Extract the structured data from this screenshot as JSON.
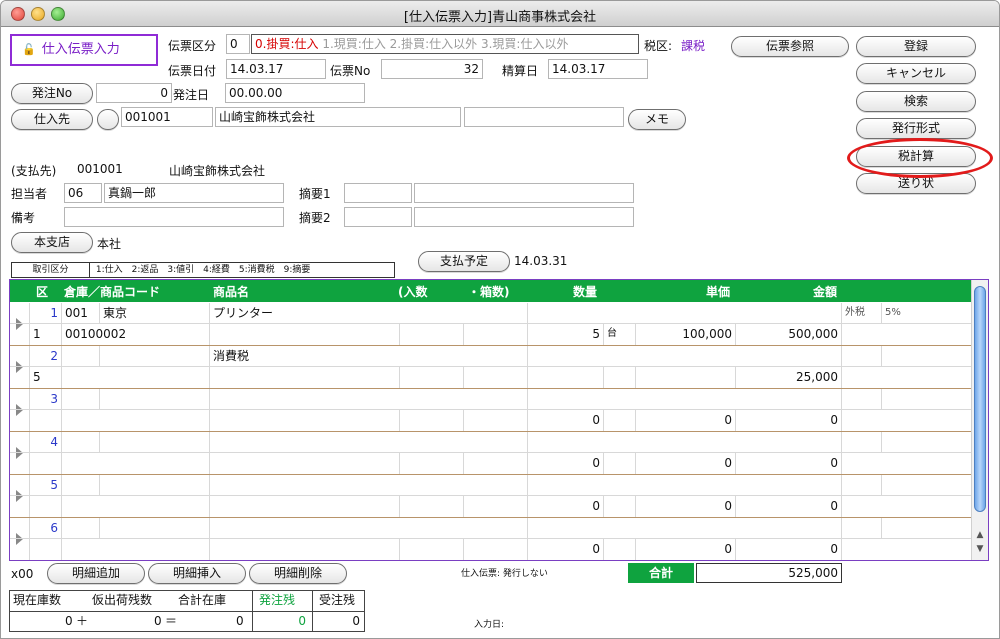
{
  "window": {
    "title": "[仕入伝票入力]青山商事株式会社"
  },
  "header": {
    "mode_badge": "仕入伝票入力",
    "denpyo_kubun_label": "伝票区分",
    "denpyo_kubun_value": "0",
    "kubun_options": [
      "0.掛買:仕入",
      "1.現買:仕入",
      "2.掛買:仕入以外",
      "3.現買:仕入以外"
    ],
    "tax_label": "税区:",
    "tax_value": "課税",
    "date_label": "伝票日付",
    "date_value": "14.03.17",
    "no_label": "伝票No",
    "no_value": "32",
    "seisan_label": "精算日",
    "seisan_value": "14.03.17",
    "hacchu_no_button": "発注No",
    "hacchu_no_value": "0",
    "hacchu_date_label": "発注日",
    "hacchu_date_value": "00.00.00",
    "shiiresaki_button": "仕入先",
    "shiiresaki_code": "001001",
    "shiiresaki_name": "山崎宝飾株式会社",
    "memo_button": "メモ",
    "shiharai_label": "(支払先)",
    "shiharai_code": "001001",
    "shiharai_name": "山崎宝飾株式会社",
    "tantou_label": "担当者",
    "tantou_code": "06",
    "tantou_name": "真鍋一郎",
    "bikou_label": "備考",
    "tekiyou1_label": "摘要1",
    "tekiyou2_label": "摘要2",
    "honshiten_button": "本支店",
    "honshiten_value": "本社",
    "torihiki_kubun": "取引区分",
    "torihiki_options": "1:仕入　2:返品　3:値引　4:経費　5:消費税　9:摘要",
    "shiharai_yotei_button": "支払予定",
    "shiharai_yotei_value": "14.03.31"
  },
  "side_buttons": {
    "denpyo_sansho": "伝票参照",
    "touroku": "登録",
    "cancel": "キャンセル",
    "kensaku": "検索",
    "hakkou": "発行形式",
    "zeikeisan": "税計算",
    "okurijou": "送り状"
  },
  "grid": {
    "headers": [
      "区",
      "倉庫／商品コード",
      "商品名",
      "(入数",
      "・箱数)",
      "数量",
      "単価",
      "金額"
    ],
    "rows": [
      {
        "line": "1",
        "soko": "001",
        "soko_name": "東京",
        "name": "プリンター",
        "tax_note": "外税",
        "tax_rate": "5%",
        "kubun": "1",
        "code": "00100002",
        "qty": "5",
        "unit": "台",
        "price": "100,000",
        "amount": "500,000"
      },
      {
        "line": "2",
        "soko": "",
        "soko_name": "",
        "name": "消費税",
        "tax_note": "",
        "tax_rate": "",
        "kubun": "5",
        "code": "",
        "qty": "",
        "unit": "",
        "price": "",
        "amount": "25,000"
      },
      {
        "line": "3",
        "soko": "",
        "soko_name": "",
        "name": "",
        "tax_note": "",
        "tax_rate": "",
        "kubun": "",
        "code": "",
        "qty": "0",
        "unit": "",
        "price": "0",
        "amount": "0"
      },
      {
        "line": "4",
        "soko": "",
        "soko_name": "",
        "name": "",
        "tax_note": "",
        "tax_rate": "",
        "kubun": "",
        "code": "",
        "qty": "0",
        "unit": "",
        "price": "0",
        "amount": "0"
      },
      {
        "line": "5",
        "soko": "",
        "soko_name": "",
        "name": "",
        "tax_note": "",
        "tax_rate": "",
        "kubun": "",
        "code": "",
        "qty": "0",
        "unit": "",
        "price": "0",
        "amount": "0"
      },
      {
        "line": "6",
        "soko": "",
        "soko_name": "",
        "name": "",
        "tax_note": "",
        "tax_rate": "",
        "kubun": "",
        "code": "",
        "qty": "0",
        "unit": "",
        "price": "0",
        "amount": "0"
      }
    ]
  },
  "footer": {
    "x00": "x00",
    "add_row": "明細追加",
    "insert_row": "明細挿入",
    "delete_row": "明細削除",
    "print_status": "仕入伝票: 発行しない",
    "total_label": "合計",
    "total_value": "525,000",
    "stock_headers": [
      "現在庫数",
      "仮出荷残数",
      "合計在庫",
      "発注残",
      "受注残"
    ],
    "stock_values": [
      "0",
      "＋",
      "0",
      "＝",
      "0",
      "0",
      "0"
    ],
    "input_date_label": "入力日:"
  },
  "colors": {
    "accent_green": "#0fa33f",
    "purple": "#8f2bd6",
    "red_highlight": "#e21b1b"
  }
}
